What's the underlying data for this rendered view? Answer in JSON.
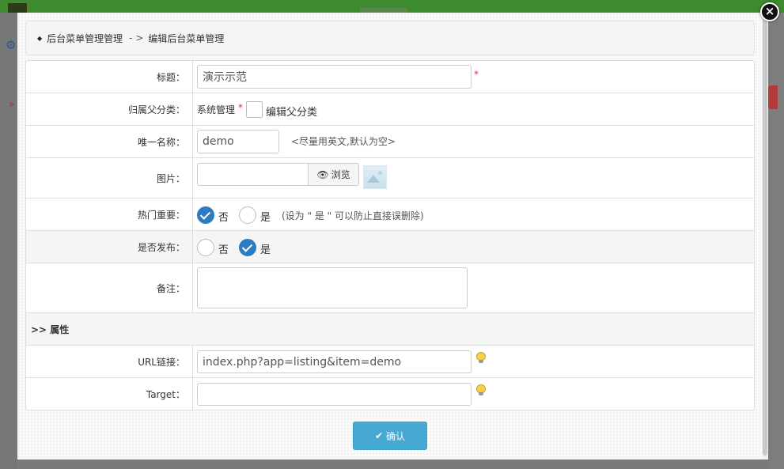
{
  "window": {
    "close_icon": "×"
  },
  "breadcrumb": {
    "parent": "后台菜单管理管理",
    "separator": "- >",
    "current": "编辑后台菜单管理"
  },
  "form": {
    "title": {
      "label": "标题：",
      "value": "演示示范",
      "required_mark": "*"
    },
    "parent_category": {
      "label": "归属父分类：",
      "value": "系统管理",
      "required_mark": "*",
      "edit_label": "编辑父分类"
    },
    "unique_name": {
      "label": "唯一名称：",
      "value": "demo",
      "hint": "<尽量用英文,默认为空>"
    },
    "image": {
      "label": "图片：",
      "value": "",
      "browse_label": "浏览"
    },
    "hot_important": {
      "label": "热门重要：",
      "option_no": "否",
      "option_yes": "是",
      "selected": "否",
      "hint": "(设为 \" 是 \" 可以防止直接误删除)"
    },
    "publish": {
      "label": "是否发布：",
      "option_no": "否",
      "option_yes": "是",
      "selected": "是"
    },
    "remark": {
      "label": "备注：",
      "value": ""
    },
    "attributes_section": {
      "label": ">> 属性"
    },
    "url_link": {
      "label": "URL链接：",
      "value": "index.php?app=listing&item=demo"
    },
    "target": {
      "label": "Target：",
      "value": ""
    }
  },
  "actions": {
    "confirm_label": "确认"
  },
  "colors": {
    "accent": "#45a9d1",
    "radio_selected": "#2b7cc2",
    "required": "#d9333f"
  }
}
